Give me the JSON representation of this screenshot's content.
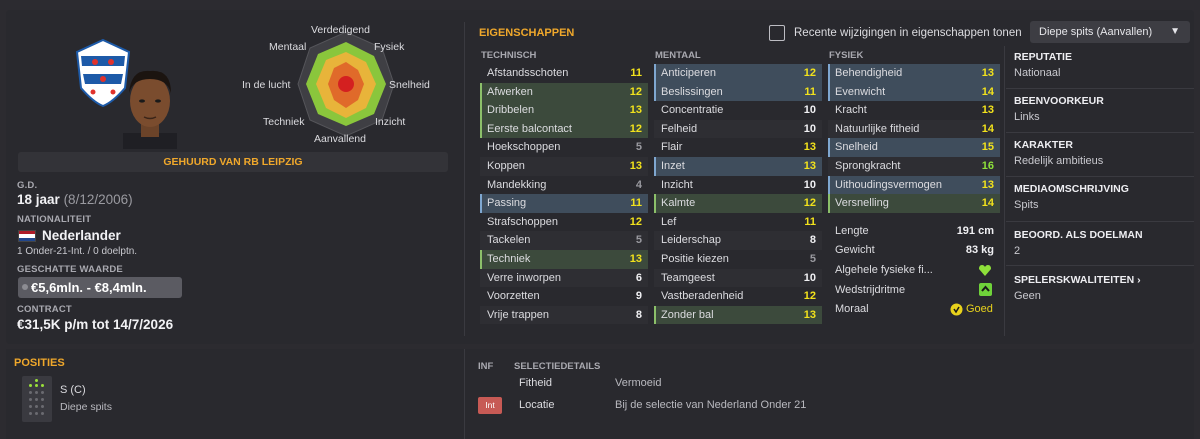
{
  "player": {
    "hire_label": "GEHUURD VAN RB LEIPZIG",
    "dob_label": "G.D.",
    "age": "18 jaar",
    "dob": "(8/12/2006)",
    "nationality_label": "NATIONALITEIT",
    "nationality": "Nederlander",
    "caps": "1 Onder-21-Int. / 0 doelptn.",
    "value_label": "GESCHATTE WAARDE",
    "value": "€5,6mln. - €8,4mln.",
    "contract_label": "CONTRACT",
    "contract": "€31,5K p/m tot 14/7/2026",
    "club_badge_text": "sc Heerenveen"
  },
  "radar": {
    "labels": {
      "top": "Verdedigend",
      "top_left": "Mentaal",
      "top_right": "Fysiek",
      "left": "In de lucht",
      "right": "Snelheid",
      "bottom_left": "Techniek",
      "bottom_right": "Inzicht",
      "bottom": "Aanvallend"
    }
  },
  "attributes": {
    "title": "EIGENSCHAPPEN",
    "checkbox_label": "Recente wijzigingen in eigenschappen tonen",
    "role_dropdown": "Diepe spits (Aanvallen)",
    "technical": {
      "header": "TECHNISCH",
      "rows": [
        {
          "name": "Afstandsschoten",
          "value": "11",
          "hl": "",
          "c": "y"
        },
        {
          "name": "Afwerken",
          "value": "12",
          "hl": "green",
          "c": "y"
        },
        {
          "name": "Dribbelen",
          "value": "13",
          "hl": "green",
          "c": "y"
        },
        {
          "name": "Eerste balcontact",
          "value": "12",
          "hl": "green",
          "c": "y"
        },
        {
          "name": "Hoekschoppen",
          "value": "5",
          "hl": "",
          "c": "gr"
        },
        {
          "name": "Koppen",
          "value": "13",
          "hl": "",
          "c": "y"
        },
        {
          "name": "Mandekking",
          "value": "4",
          "hl": "",
          "c": "gr"
        },
        {
          "name": "Passing",
          "value": "11",
          "hl": "blue",
          "c": "y"
        },
        {
          "name": "Strafschoppen",
          "value": "12",
          "hl": "",
          "c": "y"
        },
        {
          "name": "Tackelen",
          "value": "5",
          "hl": "",
          "c": "gr"
        },
        {
          "name": "Techniek",
          "value": "13",
          "hl": "green",
          "c": "y"
        },
        {
          "name": "Verre inworpen",
          "value": "6",
          "hl": "",
          "c": "w"
        },
        {
          "name": "Voorzetten",
          "value": "9",
          "hl": "",
          "c": "w"
        },
        {
          "name": "Vrije trappen",
          "value": "8",
          "hl": "",
          "c": "w"
        }
      ]
    },
    "mental": {
      "header": "MENTAAL",
      "rows": [
        {
          "name": "Anticiperen",
          "value": "12",
          "hl": "blue",
          "c": "y"
        },
        {
          "name": "Beslissingen",
          "value": "11",
          "hl": "blue",
          "c": "y"
        },
        {
          "name": "Concentratie",
          "value": "10",
          "hl": "",
          "c": "w"
        },
        {
          "name": "Felheid",
          "value": "10",
          "hl": "",
          "c": "w"
        },
        {
          "name": "Flair",
          "value": "13",
          "hl": "",
          "c": "y"
        },
        {
          "name": "Inzet",
          "value": "13",
          "hl": "blue",
          "c": "y"
        },
        {
          "name": "Inzicht",
          "value": "10",
          "hl": "",
          "c": "w"
        },
        {
          "name": "Kalmte",
          "value": "12",
          "hl": "green",
          "c": "y"
        },
        {
          "name": "Lef",
          "value": "11",
          "hl": "",
          "c": "y"
        },
        {
          "name": "Leiderschap",
          "value": "8",
          "hl": "",
          "c": "w"
        },
        {
          "name": "Positie kiezen",
          "value": "5",
          "hl": "",
          "c": "gr"
        },
        {
          "name": "Teamgeest",
          "value": "10",
          "hl": "",
          "c": "w"
        },
        {
          "name": "Vastberadenheid",
          "value": "12",
          "hl": "",
          "c": "y"
        },
        {
          "name": "Zonder bal",
          "value": "13",
          "hl": "green",
          "c": "y"
        }
      ]
    },
    "physical": {
      "header": "FYSIEK",
      "rows": [
        {
          "name": "Behendigheid",
          "value": "13",
          "hl": "blue",
          "c": "y"
        },
        {
          "name": "Evenwicht",
          "value": "14",
          "hl": "blue",
          "c": "y"
        },
        {
          "name": "Kracht",
          "value": "13",
          "hl": "",
          "c": "y"
        },
        {
          "name": "Natuurlijke fitheid",
          "value": "14",
          "hl": "",
          "c": "y"
        },
        {
          "name": "Snelheid",
          "value": "15",
          "hl": "blue",
          "c": "y"
        },
        {
          "name": "Sprongkracht",
          "value": "16",
          "hl": "",
          "c": "g"
        },
        {
          "name": "Uithoudingsvermogen",
          "value": "13",
          "hl": "blue",
          "c": "y"
        },
        {
          "name": "Versnelling",
          "value": "14",
          "hl": "green",
          "c": "y"
        }
      ]
    },
    "body": {
      "length_label": "Lengte",
      "length": "191 cm",
      "weight_label": "Gewicht",
      "weight": "83 kg",
      "fitness_label": "Algehele fysieke fi...",
      "match_sharpness_label": "Wedstrijdritme",
      "morale_label": "Moraal",
      "morale": "Goed"
    }
  },
  "info": {
    "reputation_label": "REPUTATIE",
    "reputation": "Nationaal",
    "foot_label": "BEENVOORKEUR",
    "foot": "Links",
    "character_label": "KARAKTER",
    "character": "Redelijk ambitieus",
    "media_label": "MEDIAOMSCHRIJVING",
    "media": "Spits",
    "gk_label": "BEOORD. ALS DOELMAN",
    "gk": "2",
    "qualities_label": "SPELERSKWALITEITEN",
    "qualities": "Geen"
  },
  "positions": {
    "title": "POSITIES",
    "pos": "S (C)",
    "role": "Diepe spits"
  },
  "selection": {
    "col_inf": "INF",
    "col_details": "SELECTIEDETAILS",
    "rows": [
      {
        "badge": "",
        "label": "Fitheid",
        "value": "Vermoeid"
      },
      {
        "badge": "Int",
        "label": "Locatie",
        "value": "Bij de selectie van Nederland Onder 21"
      }
    ]
  },
  "colors": {
    "accent": "#f0a82b",
    "value_yellow": "#f2e21c",
    "value_green": "#8ee03a",
    "highlight_blue": "#3f4d5c",
    "highlight_green": "#3c4a3c"
  }
}
